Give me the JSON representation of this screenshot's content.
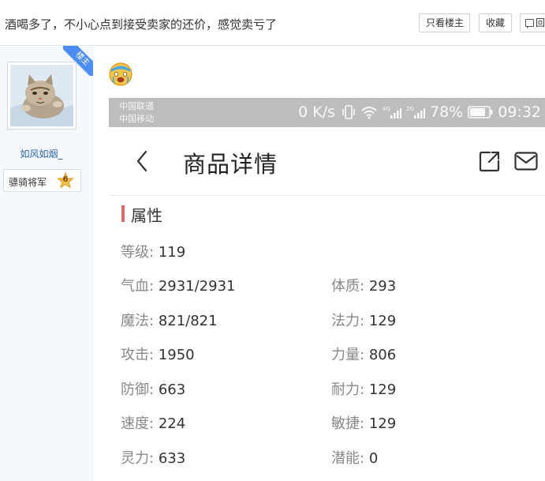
{
  "topbar": {
    "thread_title": "酒喝多了，不小心点到接受卖家的还价，感觉卖亏了",
    "only_author_label": "只看楼主",
    "favorite_label": "收藏",
    "reply_label": "回"
  },
  "sidebar": {
    "op_ribbon": "楼主",
    "username": "如风如烟_",
    "rank_title": "骠骑将军",
    "rank_level": "6"
  },
  "screenshot": {
    "status": {
      "carrier1": "中国联通",
      "carrier2": "中国移动",
      "speed": "0 K/s",
      "battery": "78%",
      "time": "09:32"
    },
    "appbar": {
      "title": "商品详情"
    },
    "section": {
      "title": "属性"
    },
    "attributes": [
      {
        "label": "等级:",
        "value": "119"
      },
      {
        "label": "气血:",
        "value": "2931/2931"
      },
      {
        "label": "体质:",
        "value": "293"
      },
      {
        "label": "魔法:",
        "value": "821/821"
      },
      {
        "label": "法力:",
        "value": "129"
      },
      {
        "label": "攻击:",
        "value": "1950"
      },
      {
        "label": "力量:",
        "value": "806"
      },
      {
        "label": "防御:",
        "value": "663"
      },
      {
        "label": "耐力:",
        "value": "129"
      },
      {
        "label": "速度:",
        "value": "224"
      },
      {
        "label": "敏捷:",
        "value": "129"
      },
      {
        "label": "灵力:",
        "value": "633"
      },
      {
        "label": "潜能:",
        "value": "0"
      }
    ]
  },
  "colors": {
    "accent_blue": "#4c8df5",
    "username_blue": "#2d64b3",
    "section_red": "#e06a6a",
    "status_gray": "#bdbdbd"
  }
}
